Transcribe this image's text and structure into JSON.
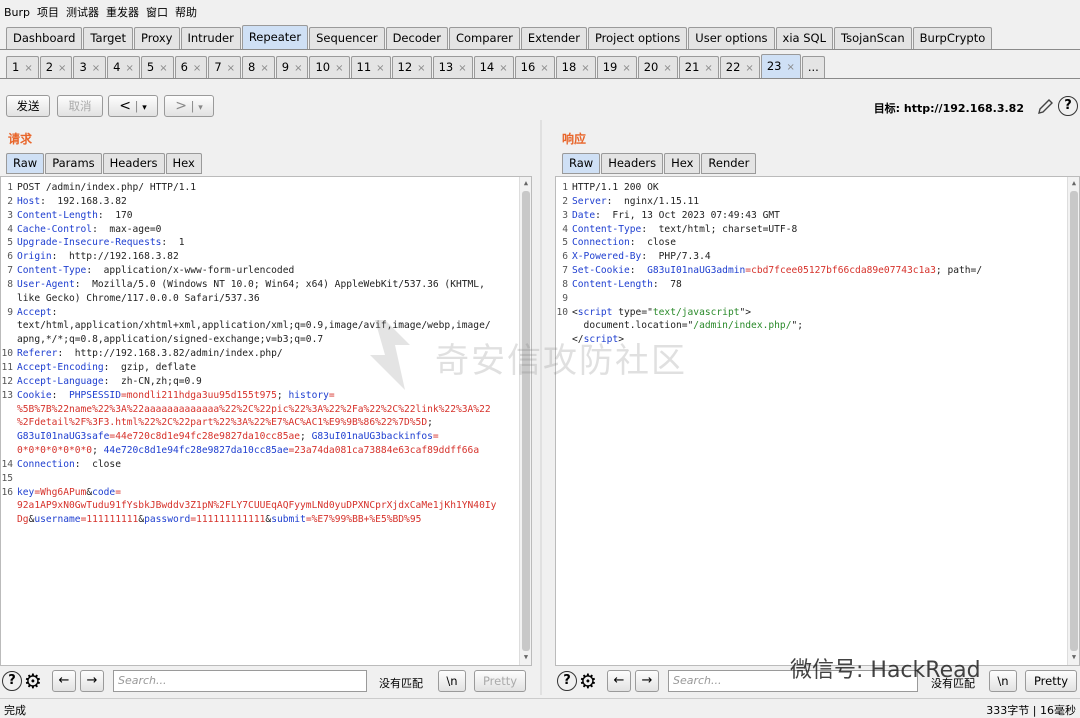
{
  "menu": [
    "Burp",
    "项目",
    "测试器",
    "重发器",
    "窗口",
    "帮助"
  ],
  "main_tabs": [
    "Dashboard",
    "Target",
    "Proxy",
    "Intruder",
    "Repeater",
    "Sequencer",
    "Decoder",
    "Comparer",
    "Extender",
    "Project options",
    "User options",
    "xia SQL",
    "TsojanScan",
    "BurpCrypto"
  ],
  "main_active": "Repeater",
  "sub_tabs": [
    "1",
    "2",
    "3",
    "4",
    "5",
    "6",
    "7",
    "8",
    "9",
    "10",
    "11",
    "12",
    "13",
    "14",
    "16",
    "18",
    "19",
    "20",
    "21",
    "22",
    "23"
  ],
  "sub_more": "...",
  "sub_close": "×",
  "toolbar": {
    "send": "发送",
    "cancel": "取消",
    "back": "<",
    "forward": ">",
    "dropdown": "▾"
  },
  "target": {
    "label": "目标: http://192.168.3.82",
    "help": "?"
  },
  "request": {
    "title": "请求",
    "tabs": [
      "Raw",
      "Params",
      "Headers",
      "Hex"
    ],
    "lines": [
      [
        {
          "t": "POST /admin/index.php/ HTTP/1.1",
          "c": "v"
        }
      ],
      [
        {
          "t": "Host",
          "c": "k"
        },
        {
          "t": ":  192.168.3.82",
          "c": "v"
        }
      ],
      [
        {
          "t": "Content-Length",
          "c": "k"
        },
        {
          "t": ":  170",
          "c": "v"
        }
      ],
      [
        {
          "t": "Cache-Control",
          "c": "k"
        },
        {
          "t": ":  max-age=0",
          "c": "v"
        }
      ],
      [
        {
          "t": "Upgrade-Insecure-Requests",
          "c": "k"
        },
        {
          "t": ":  1",
          "c": "v"
        }
      ],
      [
        {
          "t": "Origin",
          "c": "k"
        },
        {
          "t": ":  http://192.168.3.82",
          "c": "v"
        }
      ],
      [
        {
          "t": "Content-Type",
          "c": "k"
        },
        {
          "t": ":  application/x-www-form-urlencoded",
          "c": "v"
        }
      ],
      [
        {
          "t": "User-Agent",
          "c": "k"
        },
        {
          "t": ":  Mozilla/5.0 (Windows NT 10.0; Win64; x64) AppleWebKit/537.36 (KHTML,",
          "c": "v"
        }
      ],
      [
        {
          "t": "like Gecko) Chrome/117.0.0.0 Safari/537.36",
          "c": "v"
        }
      ],
      [
        {
          "t": "Accept",
          "c": "k"
        },
        {
          "t": ":",
          "c": "v"
        }
      ],
      [
        {
          "t": "text/html,application/xhtml+xml,application/xml;q=0.9,image/avif,image/webp,image/",
          "c": "v"
        }
      ],
      [
        {
          "t": "apng,*/*;q=0.8,application/signed-exchange;v=b3;q=0.7",
          "c": "v"
        }
      ],
      [
        {
          "t": "Referer",
          "c": "k"
        },
        {
          "t": ":  http://192.168.3.82/admin/index.php/",
          "c": "v"
        }
      ],
      [
        {
          "t": "Accept-Encoding",
          "c": "k"
        },
        {
          "t": ":  gzip, deflate",
          "c": "v"
        }
      ],
      [
        {
          "t": "Accept-Language",
          "c": "k"
        },
        {
          "t": ":  zh-CN,zh;q=0.9",
          "c": "v"
        }
      ],
      [
        {
          "t": "Cookie",
          "c": "k"
        },
        {
          "t": ":  ",
          "c": "v"
        },
        {
          "t": "PHPSESSID",
          "c": "k"
        },
        {
          "t": "=mondli211hdga3uu95d155t975",
          "c": "r"
        },
        {
          "t": "; ",
          "c": "v"
        },
        {
          "t": "history",
          "c": "k"
        },
        {
          "t": "=",
          "c": "r"
        }
      ],
      [
        {
          "t": "%5B%7B%22name%22%3A%22aaaaaaaaaaaaa%22%2C%22pic%22%3A%22%2Fa%22%2C%22link%22%3A%22",
          "c": "r"
        }
      ],
      [
        {
          "t": "%2Fdetail%2F%3F3.html%22%2C%22part%22%3A%22%E7%AC%AC1%E9%9B%86%22%7D%5D",
          "c": "r"
        },
        {
          "t": ";",
          "c": "v"
        }
      ],
      [
        {
          "t": "G83uI01naUG3safe",
          "c": "k"
        },
        {
          "t": "=44e720c8d1e94fc28e9827da10cc85ae",
          "c": "r"
        },
        {
          "t": "; ",
          "c": "v"
        },
        {
          "t": "G83uI01naUG3backinfos",
          "c": "k"
        },
        {
          "t": "=",
          "c": "r"
        }
      ],
      [
        {
          "t": "0*0*0*0*0*0*0",
          "c": "r"
        },
        {
          "t": "; ",
          "c": "v"
        },
        {
          "t": "44e720c8d1e94fc28e9827da10cc85ae",
          "c": "k"
        },
        {
          "t": "=23a74da081ca73884e63caf89ddff66a",
          "c": "r"
        }
      ],
      [
        {
          "t": "Connection",
          "c": "k"
        },
        {
          "t": ":  close",
          "c": "v"
        }
      ],
      [
        {
          "t": "",
          "c": "v"
        }
      ],
      [
        {
          "t": "key",
          "c": "k"
        },
        {
          "t": "=Whg6APum",
          "c": "r"
        },
        {
          "t": "&",
          "c": "v"
        },
        {
          "t": "code",
          "c": "k"
        },
        {
          "t": "=",
          "c": "r"
        }
      ],
      [
        {
          "t": "92a1AP9xN0GwTudu91fYsbkJBwddv3Z1pN%2FLY7CUUEqAQFyymLNd0yuDPXNCprXjdxCaMe1jKh1YN40Iy",
          "c": "r"
        }
      ],
      [
        {
          "t": "Dg",
          "c": "r"
        },
        {
          "t": "&",
          "c": "v"
        },
        {
          "t": "username",
          "c": "k"
        },
        {
          "t": "=111111111",
          "c": "r"
        },
        {
          "t": "&",
          "c": "v"
        },
        {
          "t": "password",
          "c": "k"
        },
        {
          "t": "=111111111111",
          "c": "r"
        },
        {
          "t": "&",
          "c": "v"
        },
        {
          "t": "submit",
          "c": "k"
        },
        {
          "t": "=%E7%99%BB+%E5%BD%95",
          "c": "r"
        }
      ]
    ],
    "line_numbers": [
      "1",
      "2",
      "3",
      "4",
      "5",
      "6",
      "7",
      "8",
      "",
      "9",
      "",
      "",
      "10",
      "11",
      "12",
      "13",
      "",
      "",
      "",
      "",
      "14",
      "15",
      "16",
      "",
      ""
    ]
  },
  "response": {
    "title": "响应",
    "tabs": [
      "Raw",
      "Headers",
      "Hex",
      "Render"
    ],
    "lines": [
      [
        {
          "t": "HTTP/1.1 200 OK",
          "c": "v"
        }
      ],
      [
        {
          "t": "Server",
          "c": "k"
        },
        {
          "t": ":  nginx/1.15.11",
          "c": "v"
        }
      ],
      [
        {
          "t": "Date",
          "c": "k"
        },
        {
          "t": ":  Fri, 13 Oct 2023 07:49:43 GMT",
          "c": "v"
        }
      ],
      [
        {
          "t": "Content-Type",
          "c": "k"
        },
        {
          "t": ":  text/html; charset=UTF-8",
          "c": "v"
        }
      ],
      [
        {
          "t": "Connection",
          "c": "k"
        },
        {
          "t": ":  close",
          "c": "v"
        }
      ],
      [
        {
          "t": "X-Powered-By",
          "c": "k"
        },
        {
          "t": ":  PHP/7.3.4",
          "c": "v"
        }
      ],
      [
        {
          "t": "Set-Cookie",
          "c": "k"
        },
        {
          "t": ":  ",
          "c": "v"
        },
        {
          "t": "G83uI01naUG3admin",
          "c": "k"
        },
        {
          "t": "=cbd7fcee05127bf66cda89e07743c1a3",
          "c": "r"
        },
        {
          "t": "; path=/",
          "c": "v"
        }
      ],
      [
        {
          "t": "Content-Length",
          "c": "k"
        },
        {
          "t": ":  78",
          "c": "v"
        }
      ],
      [
        {
          "t": "",
          "c": "v"
        }
      ],
      [
        {
          "t": "<",
          "c": "v"
        },
        {
          "t": "script",
          "c": "tg"
        },
        {
          "t": " type=\"",
          "c": "v"
        },
        {
          "t": "text/javascript",
          "c": "g"
        },
        {
          "t": "\">",
          "c": "v"
        }
      ],
      [
        {
          "t": "  document.location=\"",
          "c": "v"
        },
        {
          "t": "/admin/index.php/",
          "c": "g"
        },
        {
          "t": "\";",
          "c": "v"
        }
      ],
      [
        {
          "t": "</",
          "c": "v"
        },
        {
          "t": "script",
          "c": "tg"
        },
        {
          "t": ">",
          "c": "v"
        }
      ]
    ],
    "line_numbers": [
      "1",
      "2",
      "3",
      "4",
      "5",
      "6",
      "7",
      "8",
      "9",
      "10",
      "",
      ""
    ]
  },
  "bottom": {
    "search_placeholder": "Search...",
    "no_match": "没有匹配",
    "newline_btn": "\\n",
    "pretty_btn": "Pretty",
    "help": "?",
    "gear": "⚙",
    "prev": "←",
    "next": "→"
  },
  "status": {
    "left": "完成",
    "right": "333字节 | 16毫秒"
  },
  "watermark": {
    "center": "奇安信攻防社区",
    "wechat": "微信号: HackRead"
  }
}
